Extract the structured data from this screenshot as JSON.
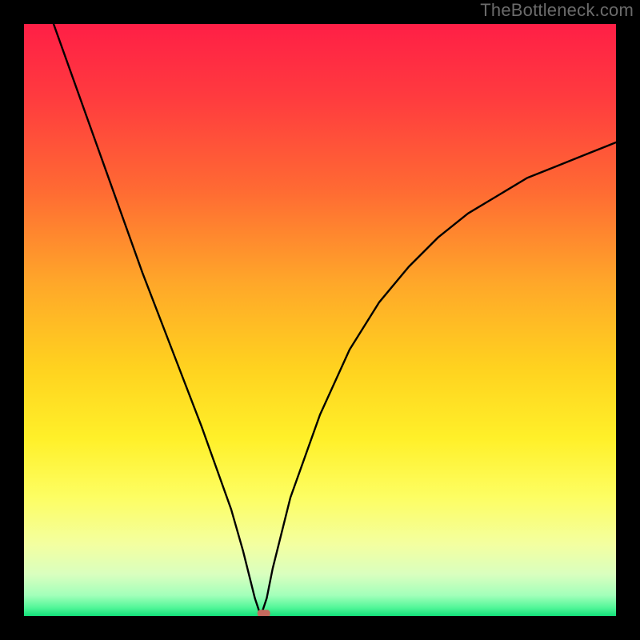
{
  "watermark": "TheBottleneck.com",
  "chart_data": {
    "type": "line",
    "title": "",
    "xlabel": "",
    "ylabel": "",
    "xlim": [
      0,
      100
    ],
    "ylim": [
      0,
      100
    ],
    "description": "Bottleneck-style V-curve over a vertical rainbow gradient (red→orange→yellow→green). The curve drops steeply from the top-left to a minimum near x≈40 at y≈0, then rises with decreasing slope toward the upper-right. A small rounded marker sits at the minimum.",
    "series": [
      {
        "name": "bottleneck-curve",
        "x": [
          5,
          10,
          15,
          20,
          25,
          30,
          35,
          37,
          38,
          39,
          40,
          41,
          42,
          45,
          50,
          55,
          60,
          65,
          70,
          75,
          80,
          85,
          90,
          95,
          100
        ],
        "y": [
          100,
          86,
          72,
          58,
          45,
          32,
          18,
          11,
          7,
          3,
          0,
          3,
          8,
          20,
          34,
          45,
          53,
          59,
          64,
          68,
          71,
          74,
          76,
          78,
          80
        ]
      }
    ],
    "marker": {
      "x": 40.5,
      "y": 0.5
    },
    "gradient_stops": [
      {
        "offset": 0.0,
        "color": "#ff1f46"
      },
      {
        "offset": 0.12,
        "color": "#ff3a3f"
      },
      {
        "offset": 0.28,
        "color": "#ff6a33"
      },
      {
        "offset": 0.44,
        "color": "#ffa829"
      },
      {
        "offset": 0.58,
        "color": "#ffd21f"
      },
      {
        "offset": 0.7,
        "color": "#fff029"
      },
      {
        "offset": 0.8,
        "color": "#fdfe63"
      },
      {
        "offset": 0.88,
        "color": "#f3ffa1"
      },
      {
        "offset": 0.93,
        "color": "#d9ffbf"
      },
      {
        "offset": 0.965,
        "color": "#a3ffba"
      },
      {
        "offset": 0.985,
        "color": "#55f79a"
      },
      {
        "offset": 1.0,
        "color": "#13e07a"
      }
    ]
  }
}
